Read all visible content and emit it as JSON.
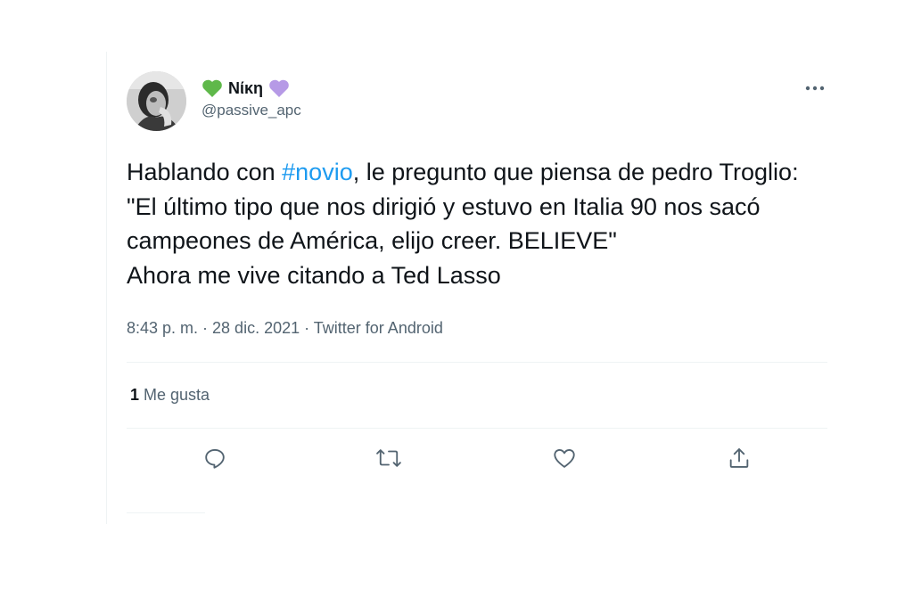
{
  "user": {
    "display_name": "Νίκη",
    "handle": "@passive_apc",
    "left_emoji": "green-heart",
    "right_emoji": "purple-heart"
  },
  "tweet": {
    "text_before_hashtag": "Hablando con ",
    "hashtag": "#novio",
    "text_after_hashtag": ", le pregunto que piensa de pedro Troglio:\n\"El último tipo que nos dirigió y estuvo en Italia 90 nos sacó campeones de América, elijo creer. BELIEVE\"\nAhora me vive citando a Ted Lasso"
  },
  "meta": {
    "timestamp": "8:43 p. m. · 28 dic. 2021 · Twitter for Android"
  },
  "stats": {
    "likes_count": "1",
    "likes_label": "Me gusta"
  },
  "actions": {
    "reply_icon": "reply-icon",
    "retweet_icon": "retweet-icon",
    "like_icon": "like-icon",
    "share_icon": "share-icon"
  },
  "colors": {
    "link": "#1d9bf0",
    "text": "#0f1419",
    "secondary": "#536471",
    "divider": "#eff3f4"
  }
}
